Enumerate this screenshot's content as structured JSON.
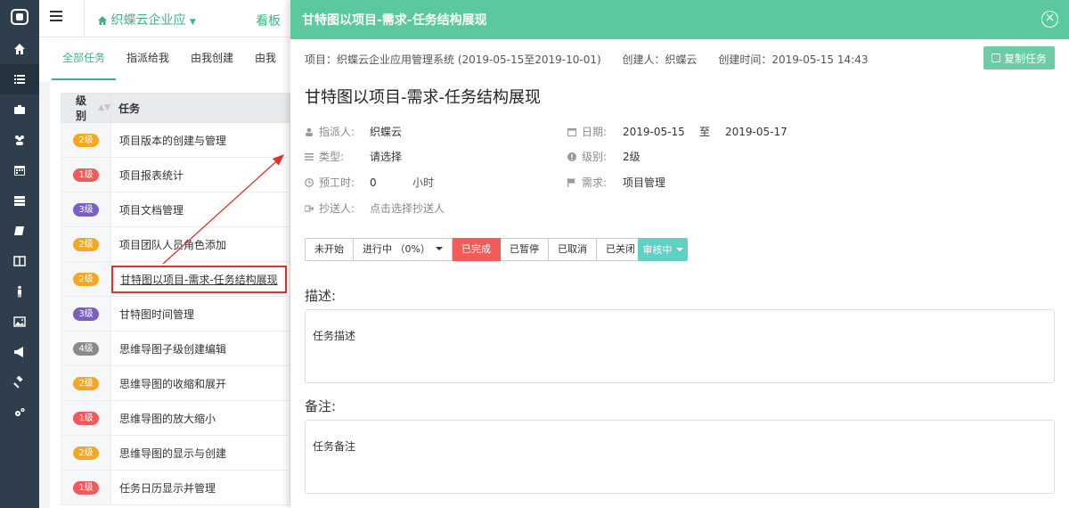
{
  "topbar": {
    "project_name": "织蝶云企业应",
    "kanban": "看板"
  },
  "tabs": [
    {
      "label": "全部任务",
      "active": true
    },
    {
      "label": "指派给我",
      "active": false
    },
    {
      "label": "由我创建",
      "active": false
    },
    {
      "label": "由我",
      "active": false
    }
  ],
  "table": {
    "headers": {
      "level": "级别",
      "task": "任务"
    },
    "rows": [
      {
        "level": "2级",
        "color": "#f5a623",
        "task": "项目版本的创建与管理"
      },
      {
        "level": "1级",
        "color": "#f05a5a",
        "task": "项目报表统计"
      },
      {
        "level": "3级",
        "color": "#7a5fc0",
        "task": "项目文档管理"
      },
      {
        "level": "2级",
        "color": "#f5a623",
        "task": "项目团队人员角色添加"
      },
      {
        "level": "2级",
        "color": "#f5a623",
        "task": "甘特图以项目-需求-任务结构展现",
        "highlight": true
      },
      {
        "level": "3级",
        "color": "#7a5fc0",
        "task": "甘特图时间管理"
      },
      {
        "level": "4级",
        "color": "#8a8a8a",
        "task": "思维导图子级创建编辑"
      },
      {
        "level": "2级",
        "color": "#f5a623",
        "task": "思维导图的收缩和展开"
      },
      {
        "level": "1级",
        "color": "#f05a5a",
        "task": "思维导图的放大缩小"
      },
      {
        "level": "2级",
        "color": "#f5a623",
        "task": "思维导图的显示与创建"
      },
      {
        "level": "1级",
        "color": "#f05a5a",
        "task": "任务日历显示并管理"
      }
    ]
  },
  "panel": {
    "header_title": "甘特图以项目-需求-任务结构展现",
    "meta": {
      "project": "项目：织蝶云企业应用管理系统 (2019-05-15至2019-10-01)",
      "creator": "创建人：织蝶云",
      "created_time": "创建时间：2019-05-15 14:43"
    },
    "copy_label": "复制任务",
    "title": "甘特图以项目-需求-任务结构展现",
    "fields": {
      "assignee_label": "指派人:",
      "assignee": "织蝶云",
      "type_label": "类型:",
      "type": "请选择",
      "hours_label": "预工时:",
      "hours": "0",
      "hours_unit": "小时",
      "cc_label": "抄送人:",
      "cc": "点击选择抄送人",
      "date_label": "日期:",
      "date_start": "2019-05-15",
      "date_to": "至",
      "date_end": "2019-05-17",
      "level_label": "级别:",
      "level": "2级",
      "req_label": "需求:",
      "req": "项目管理"
    },
    "status_buttons": [
      "未开始",
      "进行中 （0%）",
      "已完成",
      "已暂停",
      "已取消",
      "已关闭"
    ],
    "review_label": "审核中",
    "desc_title": "描述:",
    "desc": "任务描述",
    "note_title": "备注:",
    "note": "任务备注"
  }
}
